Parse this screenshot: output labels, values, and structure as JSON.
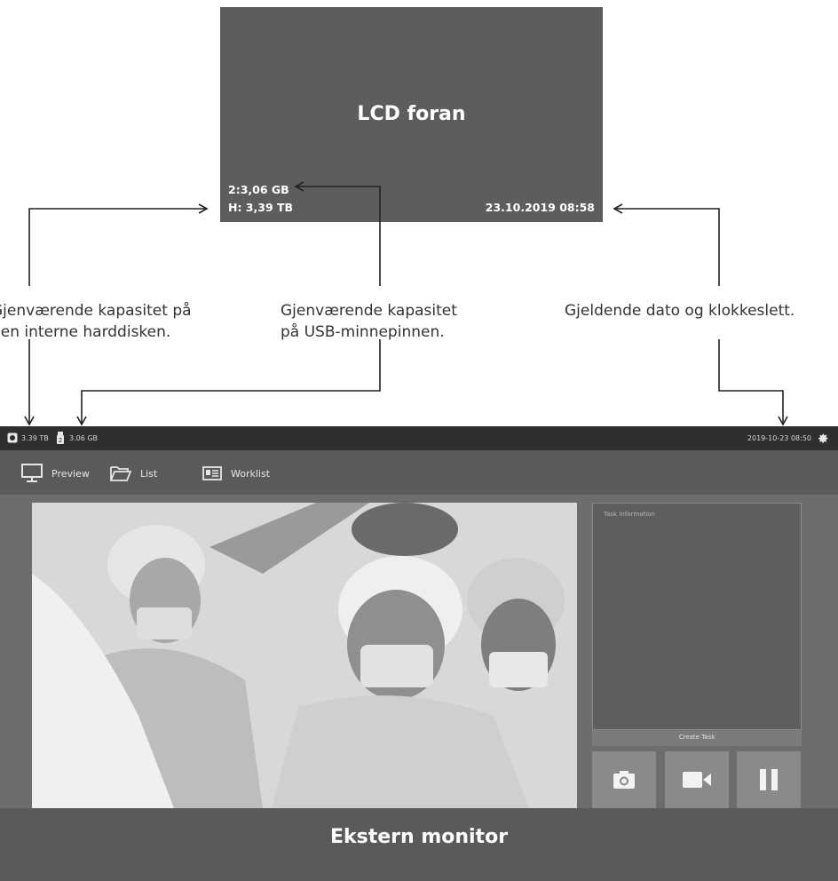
{
  "lcd": {
    "title": "LCD foran",
    "usb_capacity": "2:3,06 GB",
    "hdd_capacity": "H: 3,39 TB",
    "datetime": "23.10.2019 08:58"
  },
  "callouts": {
    "hdd": [
      "Gjenværende kapasitet på",
      "den interne harddisken."
    ],
    "usb": [
      "Gjenværende kapasitet",
      "på USB-minnepinnen."
    ],
    "datetime": [
      "Gjeldende dato og klokkeslett."
    ]
  },
  "monitor": {
    "status_hdd": "3.39 TB",
    "status_usb": "3.06 GB",
    "status_datetime": "2019-10-23  08:50",
    "nav": {
      "preview": "Preview",
      "list": "List",
      "worklist": "Worklist"
    },
    "task_panel_title": "Task Information",
    "create_task": "Create Task",
    "label": "Ekstern monitor",
    "controls": [
      "camera-icon",
      "video-icon",
      "pause-icon"
    ]
  },
  "colors": {
    "lcd_bg": "#5d5d5d",
    "status_bar": "#2e2e2e",
    "monitor_bg": "#6d6d6d"
  }
}
